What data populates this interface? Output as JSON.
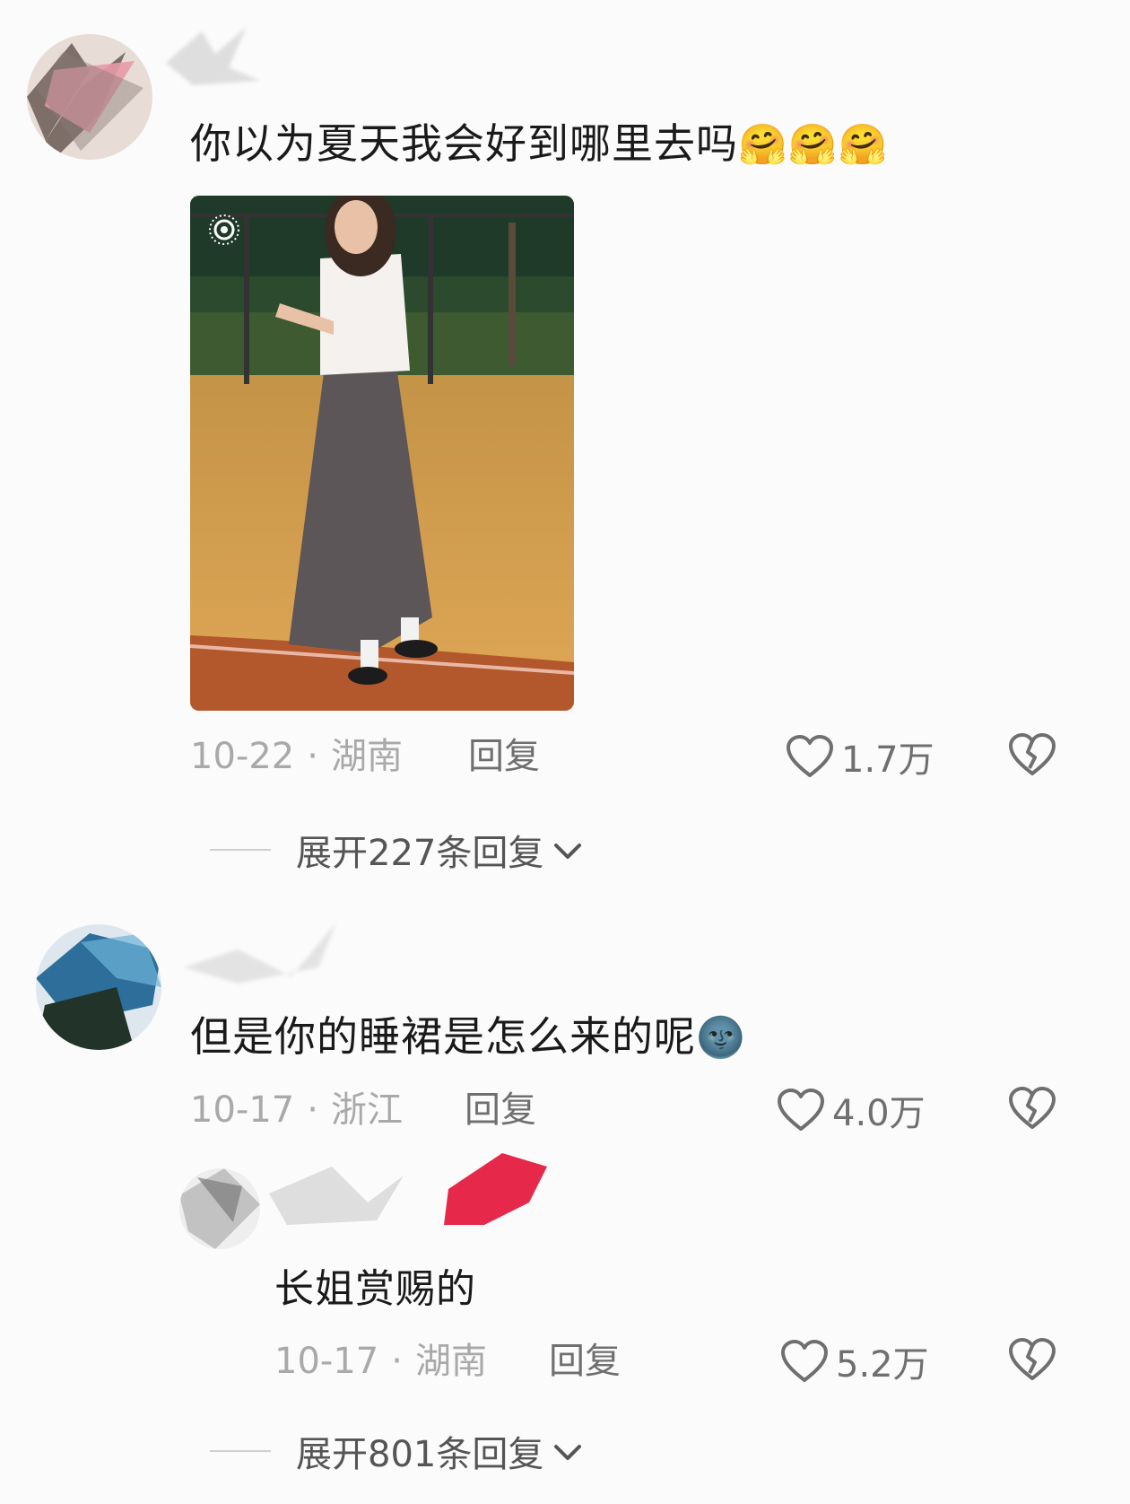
{
  "comments": [
    {
      "text": "你以为夏天我会好到哪里去吗",
      "emojis": [
        "🤗",
        "🤗",
        "🤗"
      ],
      "has_image": true,
      "date": "10-22",
      "location": "湖南",
      "reply_label": "回复",
      "likes": "1.7万",
      "expand_label": "展开227条回复"
    },
    {
      "text": "但是你的睡裙是怎么来的呢",
      "emojis": [
        "🌚"
      ],
      "date": "10-17",
      "location": "浙江",
      "reply_label": "回复",
      "likes": "4.0万",
      "replies": [
        {
          "text": "长姐赏赐的",
          "date": "10-17",
          "location": "湖南",
          "reply_label": "回复",
          "likes": "5.2万"
        }
      ],
      "expand_label": "展开801条回复"
    }
  ],
  "meta_separator": "·",
  "icons": {
    "like": "heart-outline-icon",
    "dislike": "broken-heart-icon",
    "expand": "chevron-down-icon",
    "live_photo": "live-photo-icon"
  }
}
